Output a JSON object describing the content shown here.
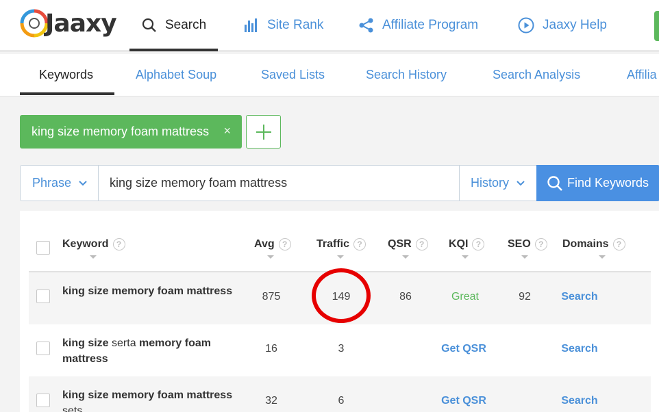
{
  "brand": {
    "name": "Jaaxy"
  },
  "topnav": {
    "search": "Search",
    "site_rank": "Site Rank",
    "affiliate": "Affiliate Program",
    "help": "Jaaxy Help"
  },
  "subtabs": [
    "Keywords",
    "Alphabet Soup",
    "Saved Lists",
    "Search History",
    "Search Analysis",
    "Affilia"
  ],
  "chip": {
    "label": "king size memory foam mattress",
    "close": "×"
  },
  "searchbar": {
    "mode": "Phrase",
    "query": "king size memory foam mattress",
    "history": "History",
    "find": "Find Keywords"
  },
  "table": {
    "columns": [
      "Keyword",
      "Avg",
      "Traffic",
      "QSR",
      "KQI",
      "SEO",
      "Domains"
    ],
    "help_glyph": "?",
    "rows": [
      {
        "kw_bold1": "king size memory foam mattress",
        "kw_plain": "",
        "kw_bold2": "",
        "kw_tail": "",
        "avg": "875",
        "traffic": "149",
        "qsr": "86",
        "kqi": "Great",
        "seo": "92",
        "domains": "Search"
      },
      {
        "kw_bold1": "king size",
        "kw_plain": " serta ",
        "kw_bold2": "memory foam mattress",
        "kw_tail": "",
        "avg": "16",
        "traffic": "3",
        "qsr": "Get QSR",
        "kqi": "",
        "seo": "",
        "domains": "Search"
      },
      {
        "kw_bold1": "king size memory foam mattress",
        "kw_plain": "",
        "kw_bold2": "",
        "kw_tail": " sets",
        "avg": "32",
        "traffic": "6",
        "qsr": "Get QSR",
        "kqi": "",
        "seo": "",
        "domains": "Search"
      }
    ]
  },
  "colors": {
    "accent": "#4a90d9",
    "green": "#5cb85c",
    "highlight": "#e60000"
  }
}
